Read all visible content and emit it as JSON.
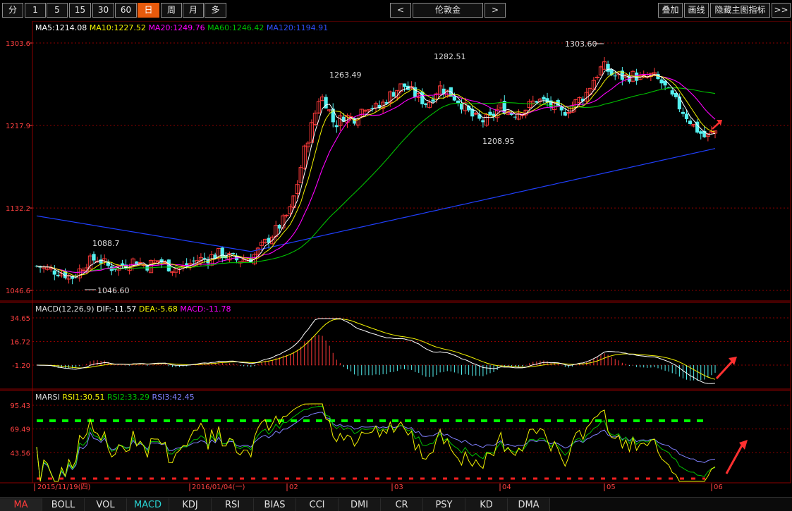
{
  "toolbar": {
    "periods": [
      "分",
      "1",
      "5",
      "15",
      "30",
      "60",
      "日",
      "周",
      "月",
      "多"
    ],
    "active_period": "日",
    "prev_label": "<",
    "symbol": "伦敦金",
    "next_label": ">",
    "right_buttons": [
      "叠加",
      "画线",
      "隐藏主图指标",
      ">>"
    ]
  },
  "legend_main": {
    "ma5": "MA5:1214.08",
    "ma10": "MA10:1227.52",
    "ma20": "MA20:1249.76",
    "ma60": "MA60:1246.42",
    "ma120": "MA120:1194.91"
  },
  "legend_macd": {
    "name": "MACD(12,26,9)",
    "dif": "DIF:-11.57",
    "dea": "DEA:-5.68",
    "macd": "MACD:-11.78"
  },
  "legend_rsi": {
    "name": "MARSI",
    "rsi1": "RSI1:30.51",
    "rsi2": "RSI2:33.29",
    "rsi3": "RSI3:42.45"
  },
  "colors": {
    "up": "#ff3a3a",
    "down": "#54f0f0",
    "ma5": "#ffffff",
    "ma10": "#f2f200",
    "ma20": "#ff00ff",
    "ma60": "#00c000",
    "ma120": "#2040ff",
    "grid": "#8b0000",
    "axis_label": "#ff4040"
  },
  "chart_data": [
    {
      "type": "candlestick",
      "title": "伦敦金",
      "ylabels": [
        "1303.6",
        "1217.9",
        "1132.2",
        "1046.6"
      ],
      "ylim": [
        1046.6,
        1303.6
      ],
      "annotations": [
        "1303.60",
        "1282.51",
        "1263.49",
        "1208.95",
        "1088.7",
        "1046.60"
      ],
      "series": [
        {
          "name": "MA5",
          "last": 1214.08
        },
        {
          "name": "MA10",
          "last": 1227.52
        },
        {
          "name": "MA20",
          "last": 1249.76
        },
        {
          "name": "MA60",
          "last": 1246.42
        },
        {
          "name": "MA120",
          "last": 1194.91
        }
      ]
    },
    {
      "type": "bar",
      "title": "MACD(12,26,9)",
      "ylabels": [
        "34.65",
        "16.72",
        "-1.20"
      ],
      "series": [
        {
          "name": "DIF",
          "last": -11.57
        },
        {
          "name": "DEA",
          "last": -5.68
        },
        {
          "name": "MACD",
          "last": -11.78
        }
      ]
    },
    {
      "type": "line",
      "title": "MARSI",
      "ylabels": [
        "95.43",
        "69.49",
        "43.56"
      ],
      "series": [
        {
          "name": "RSI1",
          "last": 30.51
        },
        {
          "name": "RSI2",
          "last": 33.29
        },
        {
          "name": "RSI3",
          "last": 42.45
        }
      ]
    }
  ],
  "xaxis": {
    "start_date": "2015/11/19(四)",
    "date2": "2016/01/04(一)",
    "months": [
      "02",
      "03",
      "04",
      "05",
      "06"
    ]
  },
  "tabs": {
    "items": [
      "MA",
      "BOLL",
      "VOL",
      "MACD",
      "KDJ",
      "RSI",
      "BIAS",
      "CCI",
      "DMI",
      "CR",
      "PSY",
      "KD",
      "DMA"
    ],
    "active": "MA",
    "selected_sub": "MACD"
  }
}
